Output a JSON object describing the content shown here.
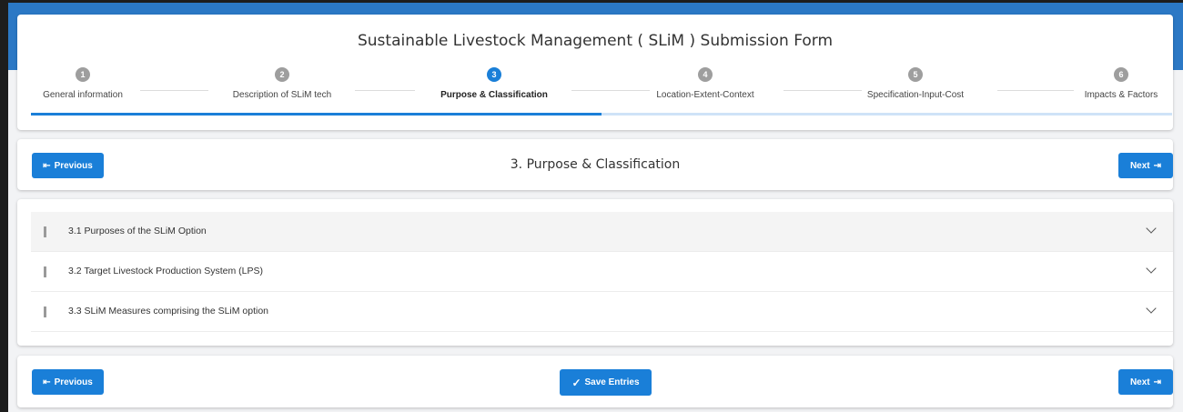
{
  "form": {
    "title": "Sustainable Livestock Management ( SLiM ) Submission Form"
  },
  "steps": [
    {
      "number": "1",
      "label": "General information"
    },
    {
      "number": "2",
      "label": "Description of SLiM tech"
    },
    {
      "number": "3",
      "label": "Purpose & Classification"
    },
    {
      "number": "4",
      "label": "Location-Extent-Context"
    },
    {
      "number": "5",
      "label": "Specification-Input-Cost"
    },
    {
      "number": "6",
      "label": "Impacts & Factors"
    }
  ],
  "active_step": 3,
  "progress_fraction": 0.5,
  "nav": {
    "previous_label": "Previous",
    "next_label": "Next",
    "title": "3. Purpose & Classification"
  },
  "sections": [
    {
      "label": "3.1 Purposes of the SLiM Option"
    },
    {
      "label": "3.2 Target Livestock Production System (LPS)"
    },
    {
      "label": "3.3 SLiM Measures comprising the SLiM option"
    }
  ],
  "bottom": {
    "previous_label": "Previous",
    "save_label": "Save Entries",
    "next_label": "Next"
  },
  "colors": {
    "accent": "#1a7fd8",
    "header_band": "#2b78c5",
    "inactive_step": "#9e9e9e",
    "progress_track": "#cfe3f7"
  },
  "icons": {
    "previous": "arrow-left-to-bar-icon",
    "next": "arrow-right-to-bar-icon",
    "save": "checkmark-icon",
    "expand": "chevron-down-icon"
  }
}
